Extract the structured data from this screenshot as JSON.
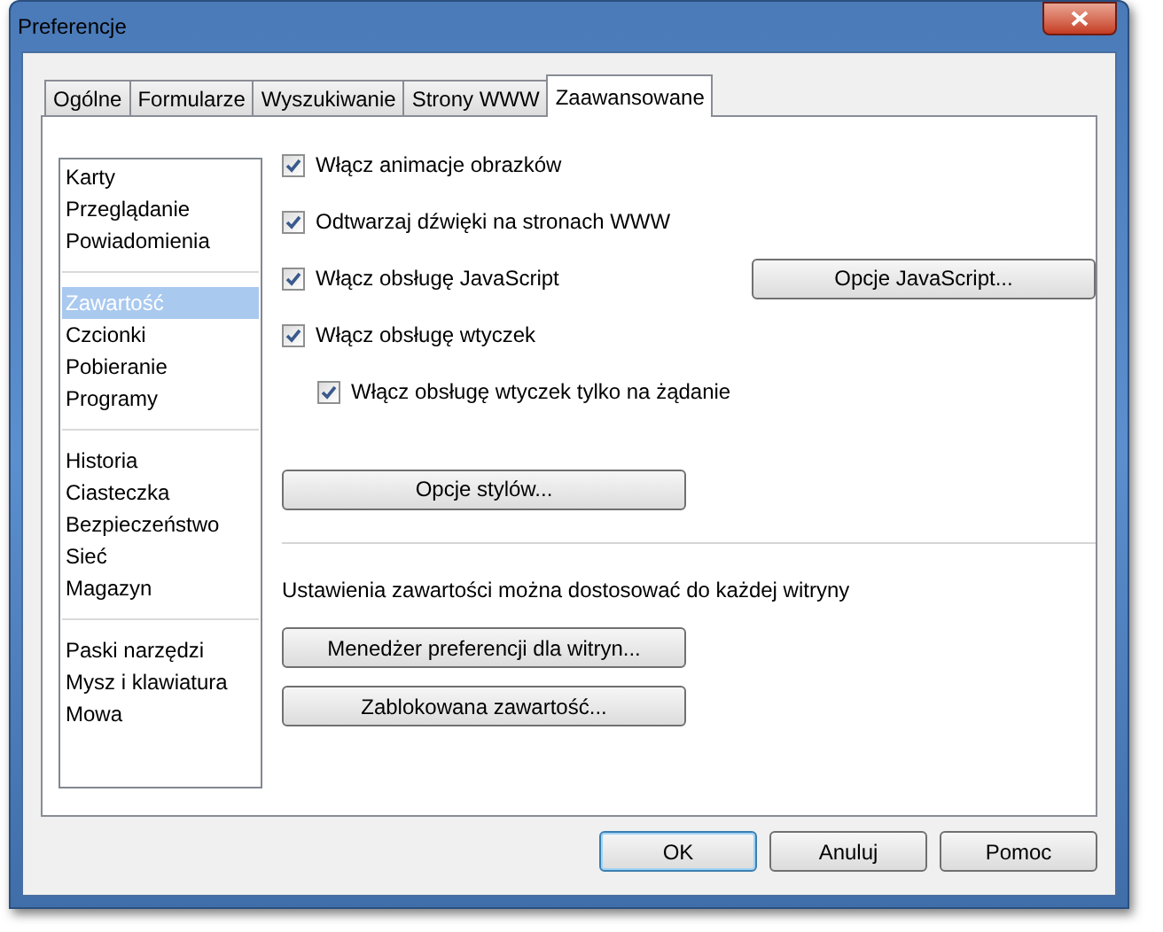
{
  "window": {
    "title": "Preferencje"
  },
  "tabs": [
    {
      "label": "Ogólne",
      "selected": false
    },
    {
      "label": "Formularze",
      "selected": false
    },
    {
      "label": "Wyszukiwanie",
      "selected": false
    },
    {
      "label": "Strony WWW",
      "selected": false
    },
    {
      "label": "Zaawansowane",
      "selected": true
    }
  ],
  "sidebar": {
    "groups": [
      {
        "items": [
          {
            "label": "Karty",
            "selected": false
          },
          {
            "label": "Przeglądanie",
            "selected": false
          },
          {
            "label": "Powiadomienia",
            "selected": false
          }
        ]
      },
      {
        "items": [
          {
            "label": "Zawartość",
            "selected": true
          },
          {
            "label": "Czcionki",
            "selected": false
          },
          {
            "label": "Pobieranie",
            "selected": false
          },
          {
            "label": "Programy",
            "selected": false
          }
        ]
      },
      {
        "items": [
          {
            "label": "Historia",
            "selected": false
          },
          {
            "label": "Ciasteczka",
            "selected": false
          },
          {
            "label": "Bezpieczeństwo",
            "selected": false
          },
          {
            "label": "Sieć",
            "selected": false
          },
          {
            "label": "Magazyn",
            "selected": false
          }
        ]
      },
      {
        "items": [
          {
            "label": "Paski narzędzi",
            "selected": false
          },
          {
            "label": "Mysz i klawiatura",
            "selected": false
          },
          {
            "label": "Mowa",
            "selected": false
          }
        ]
      }
    ]
  },
  "options": [
    {
      "label": "Włącz animacje obrazków",
      "checked": true
    },
    {
      "label": "Odtwarzaj dźwięki na stronach WWW",
      "checked": true
    },
    {
      "label": "Włącz obsługę JavaScript",
      "checked": true,
      "button": "Opcje JavaScript..."
    },
    {
      "label": "Włącz obsługę wtyczek",
      "checked": true,
      "children": [
        {
          "label": "Włącz obsługę wtyczek tylko na żądanie",
          "checked": true
        }
      ]
    }
  ],
  "styles_button": "Opcje stylów...",
  "site_settings": {
    "text": "Ustawienia zawartości można dostosować do każdej witryny",
    "buttons": [
      "Menedżer preferencji dla witryn...",
      "Zablokowana zawartość..."
    ]
  },
  "footer_buttons": [
    {
      "label": "OK",
      "default": true
    },
    {
      "label": "Anuluj",
      "default": false
    },
    {
      "label": "Pomoc",
      "default": false
    }
  ]
}
